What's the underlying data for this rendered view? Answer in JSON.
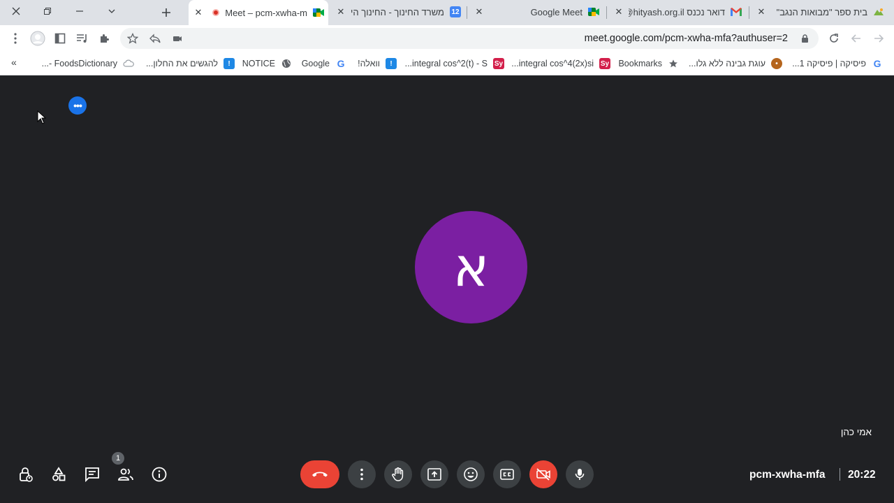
{
  "window": {
    "close_label": "✕",
    "restore_label": "❐",
    "minimize_label": "—",
    "tablist_label": "⌄",
    "newtab_label": "+"
  },
  "tabs": [
    {
      "title": "Meet – pcm-xwha-m",
      "active": true,
      "icon": "google-meet-icon"
    },
    {
      "title": "משרד החינוך - החינוך הי",
      "active": false,
      "icon": "calendar-12-icon"
    },
    {
      "title": "Google Meet",
      "active": false,
      "icon": "google-meet-icon"
    },
    {
      "title": "דואר נכנס hityash.org.il@",
      "active": false,
      "icon": "gmail-icon"
    },
    {
      "title": "בית ספר \"מבואות הנגב\"",
      "active": false,
      "icon": "school-icon"
    }
  ],
  "tab_close": "✕",
  "address_bar": {
    "url": "meet.google.com/pcm-xwha-mfa?authuser=2"
  },
  "bookmarks": {
    "more": "«",
    "items": [
      {
        "label": "פיסיקה | פיסיקה 1...",
        "icon": "google-icon"
      },
      {
        "label": "עוגת גבינה ללא גלו...",
        "icon": "recipe-icon"
      },
      {
        "label": "Bookmarks",
        "icon": "star-icon"
      },
      {
        "label": "integral cos^4(2x)si...",
        "icon": "symbolab-icon"
      },
      {
        "label": "integral cos^2(t) - S...",
        "icon": "symbolab-icon"
      },
      {
        "label": "וואלה!",
        "icon": "walla-icon"
      },
      {
        "label": "Google",
        "icon": "google-icon"
      },
      {
        "label": "NOTICE",
        "icon": "globe-icon"
      },
      {
        "label": "להגשים את החלון...",
        "icon": "walla-icon"
      },
      {
        "label": "FoodsDictionary -...",
        "icon": "cloud-icon"
      }
    ]
  },
  "meet": {
    "avatar_letter": "א",
    "participant_name": "אמי כהן",
    "meeting_code": "pcm-xwha-mfa",
    "time": "20:22",
    "participants_count": "1",
    "more_dots": "•••",
    "avatar_color": "#7b1fa2",
    "leave_color": "#ea4335"
  }
}
